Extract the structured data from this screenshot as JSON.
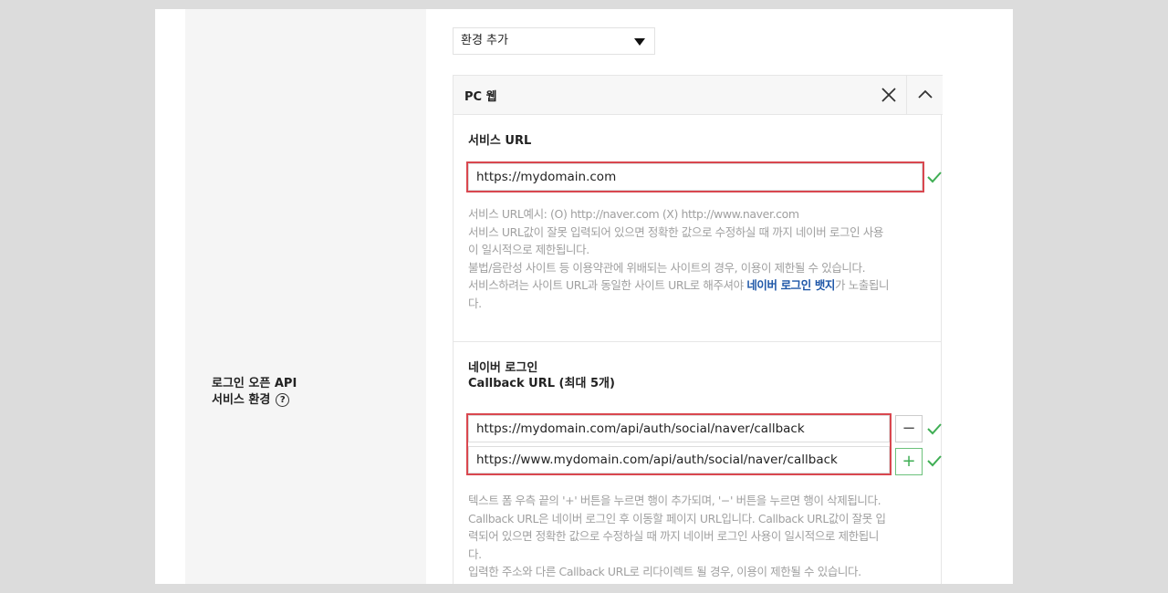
{
  "environment_select": {
    "value": "환경 추가"
  },
  "row_label": {
    "line1": "로그인 오픈 API",
    "line2": "서비스 환경",
    "help_icon": "?"
  },
  "panel": {
    "title": "PC 웹",
    "close_icon": "close-icon",
    "collapse_icon": "chevron-up-icon"
  },
  "service_url": {
    "title": "서비스 URL",
    "value": "https://mydomain.com",
    "help_lines": [
      "서비스 URL예시: (O) http://naver.com (X) http://www.naver.com",
      "서비스 URL값이 잘못 입력되어 있으면 정확한 값으로 수정하실 때 까지 네이버 로그인 사용",
      "이 일시적으로 제한됩니다.",
      "불법/음란성 사이트 등 이용약관에 위배되는 사이트의 경우, 이용이 제한될 수 있습니다."
    ],
    "help_line5_prefix": "서비스하려는 사이트 URL과 동일한 사이트 URL로 해주셔야 ",
    "help_line5_link": "네이버 로그인 뱃지",
    "help_line5_suffix": "가 노출됩니",
    "help_line6": "다."
  },
  "callback": {
    "title_line1": "네이버 로그인",
    "title_line2": "Callback URL (최대 5개)",
    "urls": [
      "https://mydomain.com/api/auth/social/naver/callback",
      "https://www.mydomain.com/api/auth/social/naver/callback"
    ],
    "minus_label": "−",
    "plus_label": "+",
    "help_lines": [
      "텍스트 폼 우측 끝의 '+' 버튼을 누르면 행이 추가되며, '−' 버튼을 누르면 행이 삭제됩니다.",
      "Callback URL은 네이버 로그인 후 이동할 페이지 URL입니다. Callback URL값이 잘못 입",
      "력되어 있으면 정확한 값으로 수정하실 때 까지 네이버 로그인 사용이 일시적으로 제한됩니",
      "다.",
      "입력한 주소와 다른 Callback URL로 리다이렉트 될 경우, 이용이 제한될 수 있습니다."
    ]
  },
  "colors": {
    "highlight_box": "#d9474f",
    "check": "#3fae54",
    "link": "#1f57a8"
  }
}
